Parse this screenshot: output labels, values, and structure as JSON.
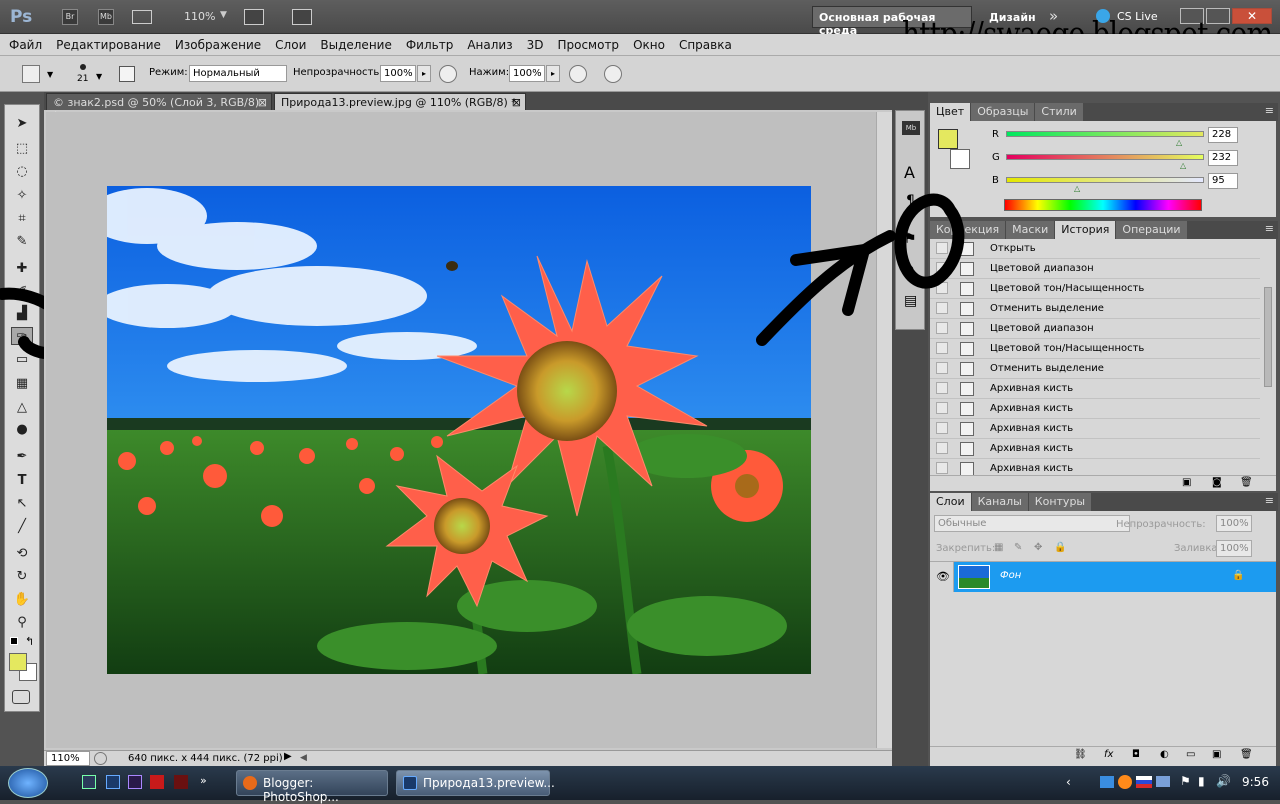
{
  "app": {
    "logo": "Ps",
    "bridge": "Br",
    "minibridge": "Mb",
    "zoom": "110%",
    "workspace_active": "Основная рабочая среда",
    "workspace_design": "Дизайн",
    "more": "»",
    "cs_live": "CS Live",
    "watermark": "http://swaego.blogspot.com"
  },
  "menu": [
    "Файл",
    "Редактирование",
    "Изображение",
    "Слои",
    "Выделение",
    "Фильтр",
    "Анализ",
    "3D",
    "Просмотр",
    "Окно",
    "Справка"
  ],
  "options": {
    "brush_size": "21",
    "mode_label": "Режим:",
    "mode_value": "Нормальный",
    "opacity_label": "Непрозрачность:",
    "opacity_value": "100%",
    "flow_label": "Нажим:",
    "flow_value": "100%"
  },
  "tabs": [
    {
      "label": "© знак2.psd @ 50% (Слой 3, RGB/8) *",
      "active": false
    },
    {
      "label": "Природа13.preview.jpg @ 110% (RGB/8) *",
      "active": true
    }
  ],
  "status": {
    "zoom": "110%",
    "doc_info": "640 пикс. x 444 пикс. (72 ppi)"
  },
  "color_panel": {
    "tabs": [
      "Цвет",
      "Образцы",
      "Стили"
    ],
    "r_label": "R",
    "r": "228",
    "g_label": "G",
    "g": "232",
    "b_label": "B",
    "b": "95",
    "fg_color": "#e4e85f"
  },
  "history_panel": {
    "tabs": [
      "Коррекция",
      "Маски",
      "История",
      "Операции"
    ],
    "snapshot": "Открыть",
    "items": [
      "Цветовой диапазон",
      "Цветовой тон/Насыщенность",
      "Отменить выделение",
      "Цветовой диапазон",
      "Цветовой тон/Насыщенность",
      "Отменить выделение",
      "Архивная кисть",
      "Архивная кисть",
      "Архивная кисть",
      "Архивная кисть",
      "Архивная кисть"
    ]
  },
  "layers_panel": {
    "tabs": [
      "Слои",
      "Каналы",
      "Контуры"
    ],
    "blend_mode": "Обычные",
    "opacity_label": "Непрозрачность:",
    "opacity_value": "100%",
    "lock_label": "Закрепить:",
    "fill_label": "Заливка:",
    "fill_value": "100%",
    "layer_name": "Фон"
  },
  "taskbar": {
    "btn1": "Blogger: PhotoShop...",
    "btn2": "Природа13.preview...",
    "clock": "9:56"
  },
  "colors": {
    "selection_blue": "#1c9bf0",
    "accent_dark": "#2d2d2d"
  }
}
